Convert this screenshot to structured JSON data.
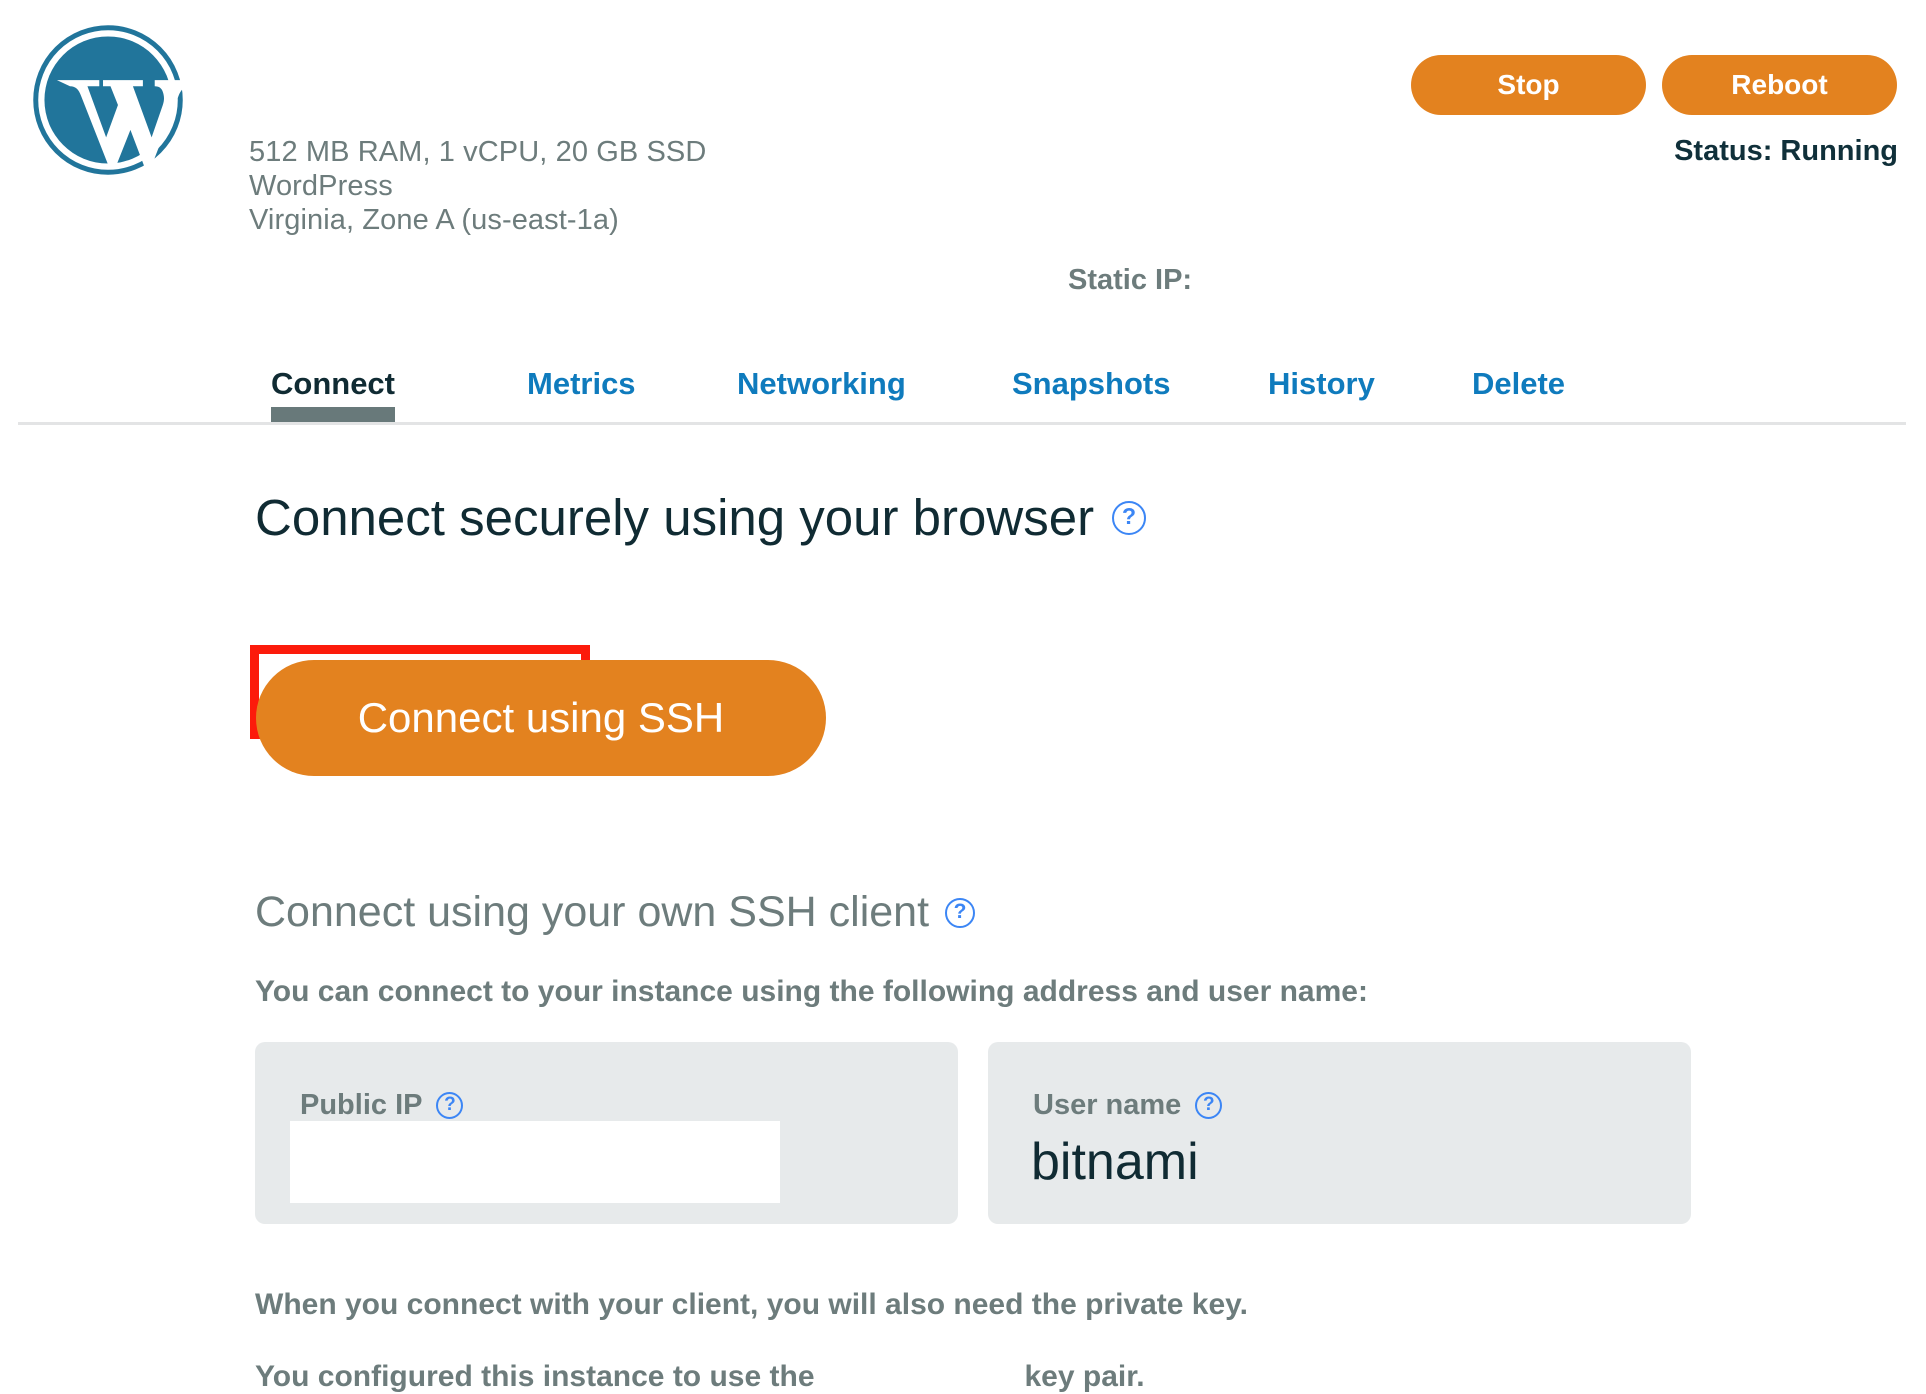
{
  "header": {
    "logo_icon": "wordpress-logo-icon",
    "logo_color": "#21759b",
    "instance_specs": "512 MB RAM, 1 vCPU, 20 GB SSD",
    "instance_blueprint": "WordPress",
    "instance_region": "Virginia, Zone A (us-east-1a)",
    "stop_label": "Stop",
    "reboot_label": "Reboot",
    "status_label": "Status:",
    "status_value": "Running",
    "static_ip_label": "Static IP:",
    "static_ip_value": "",
    "accent_color": "#e3821f"
  },
  "tabs": {
    "items": [
      {
        "label": "Connect",
        "active": true
      },
      {
        "label": "Metrics",
        "active": false
      },
      {
        "label": "Networking",
        "active": false
      },
      {
        "label": "Snapshots",
        "active": false
      },
      {
        "label": "History",
        "active": false
      },
      {
        "label": "Delete",
        "active": false
      }
    ],
    "link_color": "#0f7bbd",
    "active_color": "#102b33",
    "underline_color": "#68797a"
  },
  "main": {
    "browser_heading": "Connect securely using your browser",
    "browser_heading_help": "?",
    "connect_ssh_label": "Connect using SSH",
    "highlight_color": "#fc1b0b",
    "ssh_client_heading": "Connect using your own SSH client",
    "ssh_client_heading_help": "?",
    "address_intro": "You can connect to your instance using the following address and user name:",
    "public_ip": {
      "label": "Public IP",
      "help": "?",
      "value": ""
    },
    "user_name": {
      "label": "User name",
      "help": "?",
      "value": "bitnami"
    },
    "private_key_note": "When you connect with your client, you will also need the private key.",
    "key_pair_note_prefix": "You configured this instance to use the",
    "key_pair_note_suffix": "key pair.",
    "key_pair_name": ""
  }
}
